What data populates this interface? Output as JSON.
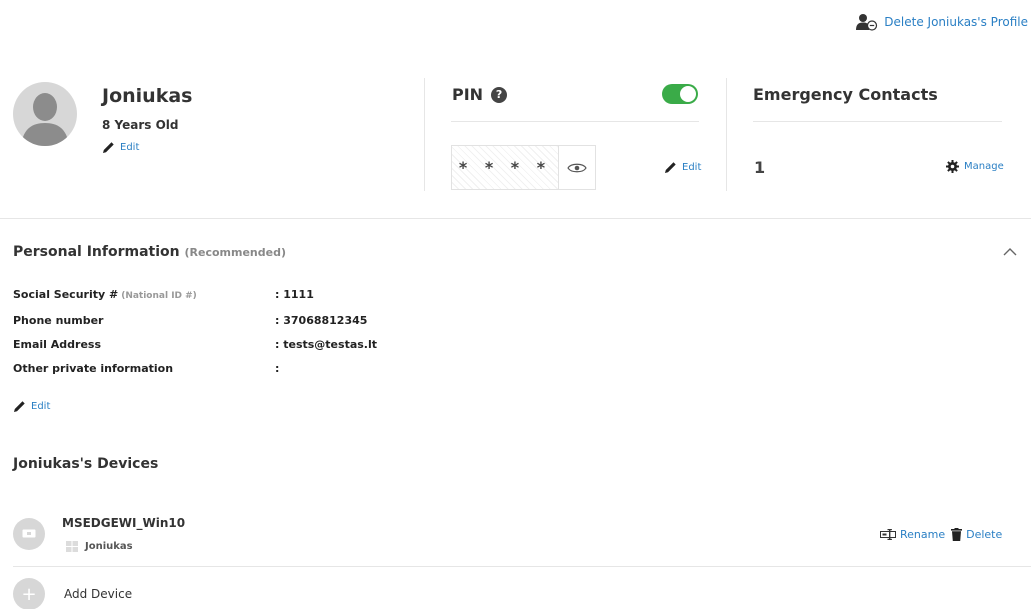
{
  "header": {
    "delete_profile_label": "Delete Joniukas's Profile"
  },
  "profile": {
    "name": "Joniukas",
    "age": "8 Years Old",
    "edit_label": "Edit"
  },
  "pin": {
    "title": "PIN",
    "help_glyph": "?",
    "enabled": true,
    "masked_value": "****",
    "edit_label": "Edit"
  },
  "emergency": {
    "title": "Emergency Contacts",
    "count": "1",
    "manage_label": "Manage"
  },
  "personal_info": {
    "title": "Personal Information",
    "title_note": "(Recommended)",
    "rows": [
      {
        "label": "Social Security #",
        "hint": "(National ID #)",
        "value": ": 1111"
      },
      {
        "label": "Phone number",
        "hint": "",
        "value": ": 37068812345"
      },
      {
        "label": "Email Address",
        "hint": "",
        "value": ": tests@testas.lt"
      },
      {
        "label": "Other private information",
        "hint": "",
        "value": ":"
      }
    ],
    "edit_label": "Edit"
  },
  "devices": {
    "title": "Joniukas's Devices",
    "items": [
      {
        "name": "MSEDGEWI_Win10",
        "owner": "Joniukas",
        "rename_label": "Rename",
        "delete_label": "Delete"
      }
    ],
    "add_label": "Add Device",
    "add_glyph": "+"
  },
  "colors": {
    "accent": "#2a7fc4",
    "toggle_on": "#3aab48",
    "avatar_bg": "#d7d7d7"
  }
}
